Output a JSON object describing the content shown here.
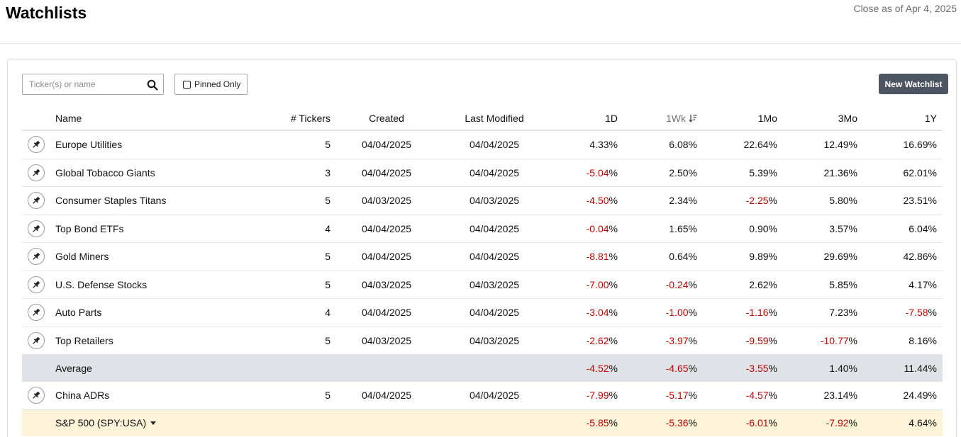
{
  "page": {
    "title": "Watchlists",
    "close_as_of": "Close as of Apr 4, 2025"
  },
  "toolbar": {
    "search_placeholder": "Ticker(s) or name",
    "search_icon": "search-icon",
    "pinned_only_label": "Pinned Only",
    "new_watchlist_label": "New Watchlist"
  },
  "table": {
    "columns": {
      "name": "Name",
      "tickers": "# Tickers",
      "created": "Created",
      "last_modified": "Last Modified",
      "d1": "1D",
      "wk1": "1Wk",
      "mo1": "1Mo",
      "mo3": "3Mo",
      "y1": "1Y"
    },
    "sorted_column": "1Wk",
    "rows": [
      {
        "name": "Europe Utilities",
        "tickers": "5",
        "created": "04/04/2025",
        "modified": "04/04/2025",
        "d1": "4.33",
        "wk1": "6.08",
        "mo1": "22.64",
        "mo3": "12.49",
        "y1": "16.69"
      },
      {
        "name": "Global Tobacco Giants",
        "tickers": "3",
        "created": "04/04/2025",
        "modified": "04/04/2025",
        "d1": "-5.04",
        "wk1": "2.50",
        "mo1": "5.39",
        "mo3": "21.36",
        "y1": "62.01"
      },
      {
        "name": "Consumer Staples Titans",
        "tickers": "5",
        "created": "04/03/2025",
        "modified": "04/03/2025",
        "d1": "-4.50",
        "wk1": "2.34",
        "mo1": "-2.25",
        "mo3": "5.80",
        "y1": "23.51"
      },
      {
        "name": "Top Bond ETFs",
        "tickers": "4",
        "created": "04/04/2025",
        "modified": "04/04/2025",
        "d1": "-0.04",
        "wk1": "1.65",
        "mo1": "0.90",
        "mo3": "3.57",
        "y1": "6.04"
      },
      {
        "name": "Gold Miners",
        "tickers": "5",
        "created": "04/04/2025",
        "modified": "04/04/2025",
        "d1": "-8.81",
        "wk1": "0.64",
        "mo1": "9.89",
        "mo3": "29.69",
        "y1": "42.86"
      },
      {
        "name": "U.S. Defense Stocks",
        "tickers": "5",
        "created": "04/03/2025",
        "modified": "04/03/2025",
        "d1": "-7.00",
        "wk1": "-0.24",
        "mo1": "2.62",
        "mo3": "5.85",
        "y1": "4.17"
      },
      {
        "name": "Auto Parts",
        "tickers": "4",
        "created": "04/04/2025",
        "modified": "04/04/2025",
        "d1": "-3.04",
        "wk1": "-1.00",
        "mo1": "-1.16",
        "mo3": "7.23",
        "y1": "-7.58"
      },
      {
        "name": "Top Retailers",
        "tickers": "5",
        "created": "04/03/2025",
        "modified": "04/03/2025",
        "d1": "-2.62",
        "wk1": "-3.97",
        "mo1": "-9.59",
        "mo3": "-10.77",
        "y1": "8.16"
      }
    ],
    "average": {
      "name": "Average",
      "d1": "-4.52",
      "wk1": "-4.65",
      "mo1": "-3.55",
      "mo3": "1.40",
      "y1": "11.44"
    },
    "rows_after": [
      {
        "name": "China ADRs",
        "tickers": "5",
        "created": "04/04/2025",
        "modified": "04/04/2025",
        "d1": "-7.99",
        "wk1": "-5.17",
        "mo1": "-4.57",
        "mo3": "23.14",
        "y1": "24.49"
      }
    ],
    "benchmark": {
      "name": "S&P 500 (SPY:USA)",
      "d1": "-5.85",
      "wk1": "-5.36",
      "mo1": "-6.01",
      "mo3": "-7.92",
      "y1": "4.64"
    }
  },
  "colors": {
    "negative": "#c00000",
    "average_bg": "#dfe3e7",
    "benchmark_bg": "#fcf3d9",
    "button_bg": "#4d5462"
  }
}
